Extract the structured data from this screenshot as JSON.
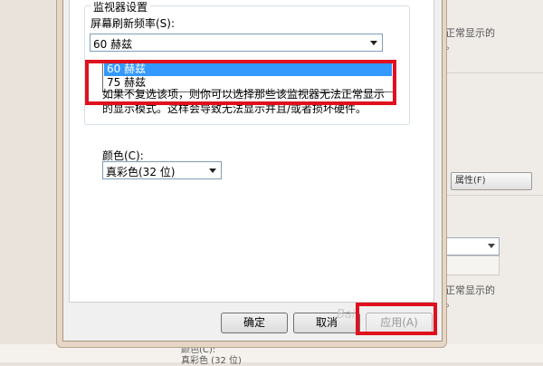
{
  "background": {
    "text_top": "正常显示的",
    "text_top2": "。",
    "properties_button": "属性(F)",
    "text_mid": "正常显示的",
    "text_mid2": "。",
    "color_label_partial": "颜色(C):",
    "color_value_partial": "真彩色 (32 位)"
  },
  "dialog": {
    "monitor_settings": {
      "legend": "监视器设置",
      "refresh_label": "屏幕刷新频率(S):",
      "refresh_value": "60 赫兹",
      "options": [
        "60 赫兹",
        "75 赫兹"
      ],
      "selected_index": 0,
      "description": "如果不复选该项，则你可以选择那些该监视器无法正常显示的显示模式。这样会导致无法显示并且/或者损坏硬件。"
    },
    "color": {
      "label": "颜色(C):",
      "value": "真彩色(32 位)"
    },
    "buttons": {
      "ok": "确定",
      "cancel": "取消",
      "apply": "应用(A)"
    }
  },
  "watermark": "Bai",
  "colors": {
    "highlight": "#e0101e",
    "selection": "#3399ff"
  }
}
